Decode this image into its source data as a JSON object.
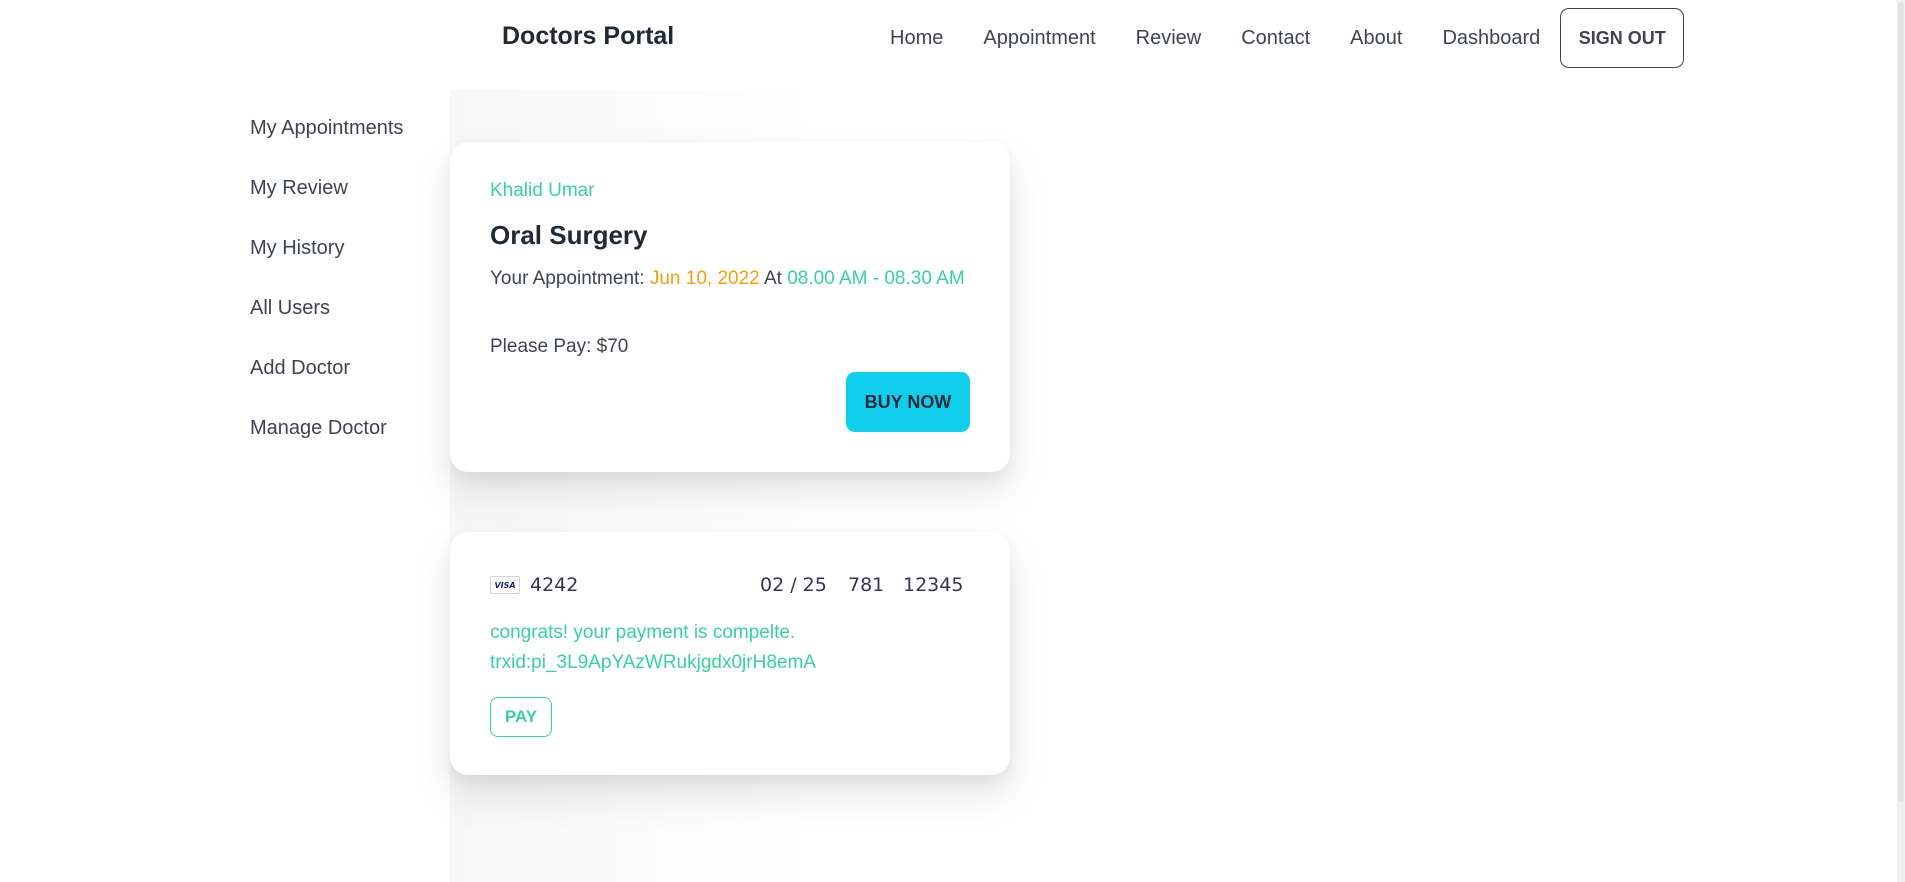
{
  "header": {
    "brand": "Doctors Portal",
    "nav": [
      "Home",
      "Appointment",
      "Review",
      "Contact",
      "About",
      "Dashboard"
    ],
    "signout_label": "SIGN OUT"
  },
  "sidebar": {
    "items": [
      {
        "label": "My Appointments"
      },
      {
        "label": "My Review"
      },
      {
        "label": "My History"
      },
      {
        "label": "All Users"
      },
      {
        "label": "Add Doctor"
      },
      {
        "label": "Manage Doctor"
      }
    ]
  },
  "appointment_card": {
    "patient": "Khalid Umar",
    "treatment": "Oral Surgery",
    "appointment_prefix": "Your Appointment: ",
    "date": "Jun 10, 2022",
    "at_label": " At ",
    "time": "08.00 AM - 08.30 AM",
    "pay_line": "Please Pay: $70",
    "buy_label": "BUY NOW"
  },
  "payment_card": {
    "brand": "VISA",
    "card_number": "4242",
    "expiry": "02 / 25",
    "cvc": "781",
    "zip": "12345",
    "success_message": "congrats! your payment is compelte.",
    "transaction": "trxid:pi_3L9ApYAzWRukjgdx0jrH8emA",
    "pay_label": "PAY"
  },
  "colors": {
    "accent": "#36d399",
    "warning": "#f59e0b",
    "primary_button": "#0fcfec",
    "text": "#3d4451"
  }
}
